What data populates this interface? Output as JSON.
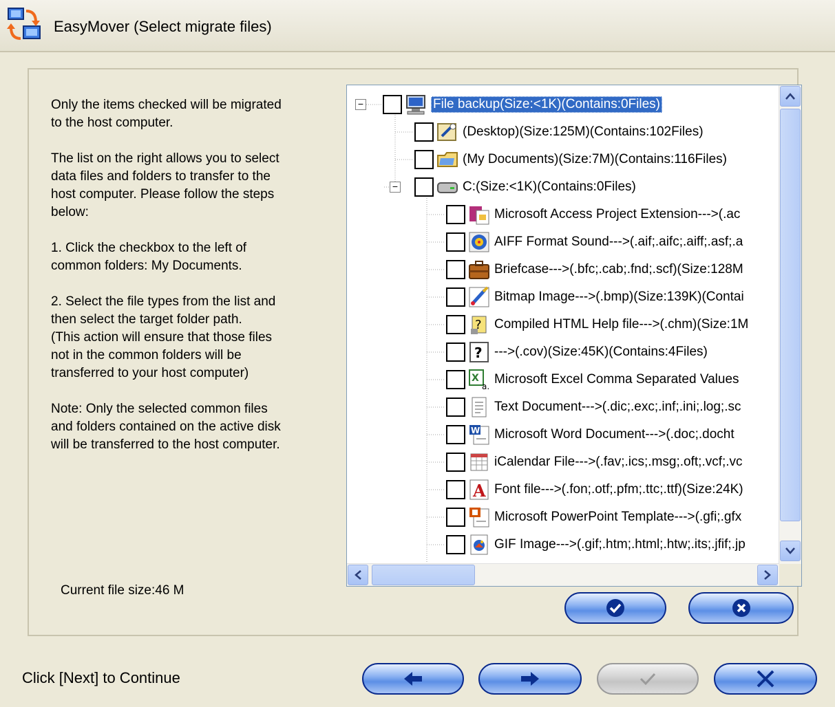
{
  "window": {
    "title": "EasyMover  (Select migrate files)",
    "app_icon": "network-computers-icon"
  },
  "instructions": [
    "Only the items checked will be migrated\nto the host computer.",
    "The list on the right allows you to select\ndata files and folders to transfer to the\nhost computer.  Please follow the steps\nbelow:",
    "1. Click the checkbox to the left of\ncommon folders: My Documents.",
    "2. Select the file types from the list and\nthen select the target folder path.\n(This action will ensure that those files\nnot in the common folders will be\ntransferred to your host computer)",
    "Note:  Only the selected common files\nand folders contained on the active disk\nwill be transferred to the host computer."
  ],
  "current_file_size": "Current file size:46 M",
  "tree": {
    "root": {
      "label": "File backup(Size:<1K)(Contains:0Files)",
      "icon": "computer-icon",
      "checked": false,
      "selected": true,
      "expanded": true
    },
    "children": [
      {
        "label": "(Desktop)(Size:125M)(Contains:102Files)",
        "icon": "desktop-icon",
        "checked": false
      },
      {
        "label": "(My Documents)(Size:7M)(Contains:116Files)",
        "icon": "folder-icon",
        "checked": false
      },
      {
        "label": "C:(Size:<1K)(Contains:0Files)",
        "icon": "drive-icon",
        "checked": false,
        "expanded": true
      }
    ],
    "file_types": [
      {
        "label": "Microsoft Access Project Extension--->(.ac",
        "icon": "access-project-icon"
      },
      {
        "label": "AIFF Format Sound--->(.aif;.aifc;.aiff;.asf;.a",
        "icon": "sound-icon"
      },
      {
        "label": "Briefcase--->(.bfc;.cab;.fnd;.scf)(Size:128M",
        "icon": "briefcase-icon"
      },
      {
        "label": "Bitmap Image--->(.bmp)(Size:139K)(Contai",
        "icon": "bitmap-icon"
      },
      {
        "label": "Compiled HTML Help file--->(.chm)(Size:1M",
        "icon": "help-file-icon"
      },
      {
        "label": "--->(.cov)(Size:45K)(Contains:4Files)",
        "icon": "unknown-file-icon"
      },
      {
        "label": "Microsoft Excel Comma Separated Values",
        "icon": "excel-csv-icon"
      },
      {
        "label": "Text Document--->(.dic;.exc;.inf;.ini;.log;.sc",
        "icon": "text-document-icon"
      },
      {
        "label": "Microsoft Word Document--->(.doc;.docht",
        "icon": "word-document-icon"
      },
      {
        "label": "iCalendar File--->(.fav;.ics;.msg;.oft;.vcf;.vc",
        "icon": "calendar-file-icon"
      },
      {
        "label": "Font file--->(.fon;.otf;.pfm;.ttc;.ttf)(Size:24K)",
        "icon": "font-file-icon"
      },
      {
        "label": "Microsoft PowerPoint Template--->(.gfi;.gfx",
        "icon": "powerpoint-template-icon"
      },
      {
        "label": "GIF Image--->(.gif;.htm;.html;.htw;.its;.jfif;.jp",
        "icon": "gif-image-icon"
      }
    ]
  },
  "buttons": {
    "ok": {
      "icon": "checkmark-icon"
    },
    "cancel_selection": {
      "icon": "close-circle-icon"
    },
    "back": {
      "icon": "arrow-left-icon"
    },
    "next": {
      "icon": "arrow-right-icon"
    },
    "finish": {
      "icon": "checkmark-icon",
      "enabled": false
    },
    "exit": {
      "icon": "close-x-icon"
    }
  },
  "status_text": "Click [Next] to Continue",
  "colors": {
    "window_bg": "#ece9d8",
    "selection": "#316ac5",
    "button_blue": "#5c8fe6",
    "button_border": "#0a2a8c"
  }
}
